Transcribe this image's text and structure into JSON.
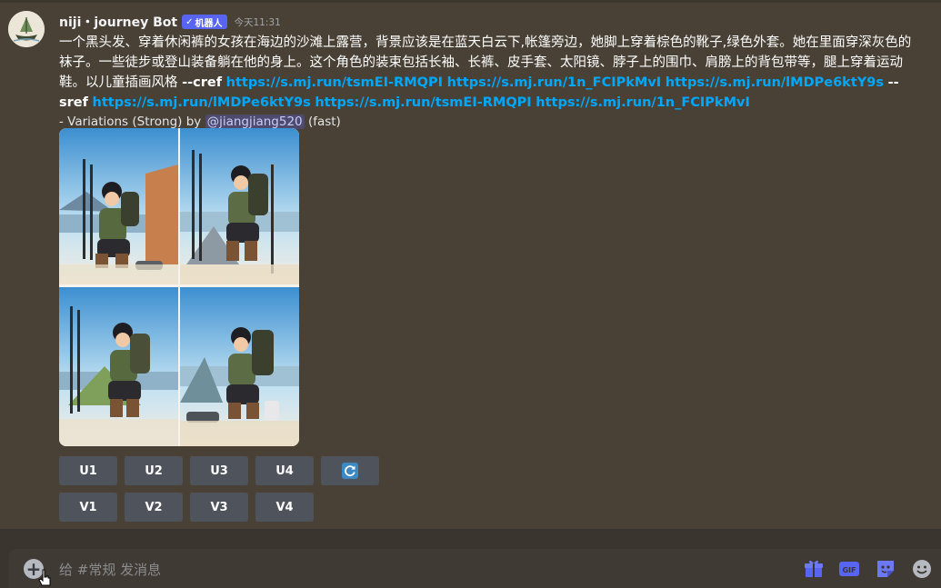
{
  "message": {
    "author": "niji・journey Bot",
    "bot_tag": "机器人",
    "timestamp": "今天11:31",
    "prompt_text": "一个黑头发、穿着休闲裤的女孩在海边的沙滩上露营，背景应该是在蓝天白云下,帐篷旁边，她脚上穿着棕色的靴子,绿色外套。她在里面穿深灰色的袜子。一些徒步或登山装备躺在他的身上。这个角色的装束包括长袖、长裤、皮手套、太阳镜、脖子上的围巾、肩膀上的背包带等，腿上穿着运动鞋。以儿童插画风格 ",
    "cref_flag": "--cref",
    "cref_links": [
      "https://s.mj.run/tsmEI-RMQPI",
      "https://s.mj.run/1n_FCIPkMvI",
      "https://s.mj.run/lMDPe6ktY9s"
    ],
    "sref_flag": "--sref",
    "sref_links": [
      "https://s.mj.run/lMDPe6ktY9s",
      "https://s.mj.run/tsmEI-RMQPI",
      "https://s.mj.run/1n_FCIPkMvI"
    ],
    "variation_prefix": "- Variations (Strong) by",
    "mention": "@jiangjiang520",
    "variation_suffix": "(fast)"
  },
  "buttons": {
    "upscale": [
      "U1",
      "U2",
      "U3",
      "U4"
    ],
    "variation": [
      "V1",
      "V2",
      "V3",
      "V4"
    ],
    "reroll_icon": "refresh-icon"
  },
  "composer": {
    "placeholder": "给 #常规 发消息"
  },
  "icons": {
    "gift": "gift-icon",
    "gif": "GIF",
    "sticker": "sticker-icon",
    "emoji": "emoji-icon"
  },
  "colors": {
    "background": "#494136",
    "link": "#00a8fc",
    "bot_tag": "#5865f2",
    "button": "#4f545c"
  }
}
